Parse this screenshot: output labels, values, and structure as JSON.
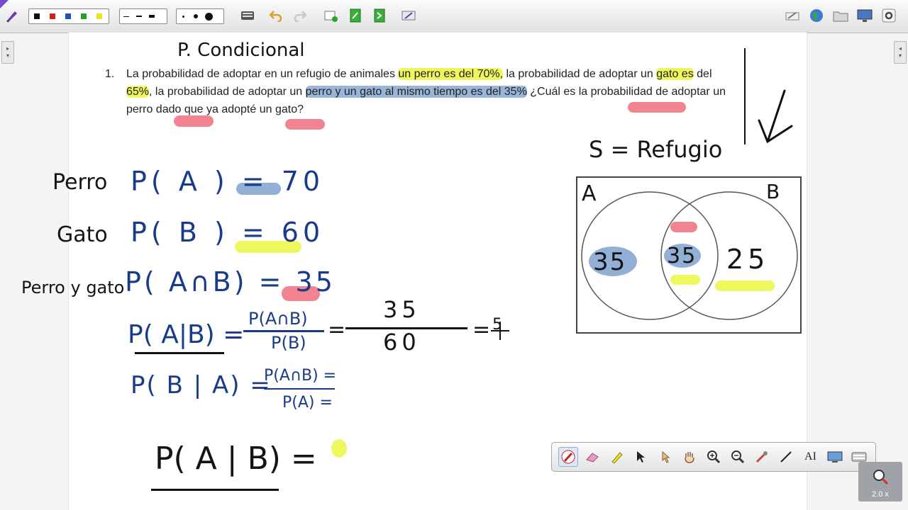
{
  "toolbar": {
    "colors": [
      "#111111",
      "#d81b1b",
      "#1f4fb0",
      "#22a022",
      "#f2e21a"
    ],
    "icons": [
      "pen-icon",
      "keyboard-icon",
      "undo-icon",
      "redo-icon",
      "new-page-icon",
      "green-page-icon",
      "green-page-arrow-icon",
      "tools-icon"
    ],
    "right_icons": [
      "pen-tray-icon",
      "globe-icon",
      "folder-icon",
      "monitor-icon",
      "settings-icon"
    ]
  },
  "problem": {
    "number": "1.",
    "segments": [
      {
        "t": "La probabilidad de adoptar en un refugio de animales ",
        "h": ""
      },
      {
        "t": "un perro es del 70%,",
        "h": "y"
      },
      {
        "t": " la probabilidad de adoptar un ",
        "h": ""
      },
      {
        "t": "gato es",
        "h": "y"
      },
      {
        "t": " del ",
        "h": ""
      },
      {
        "t": "65%",
        "h": "y"
      },
      {
        "t": ", la probabilidad de adoptar un ",
        "h": ""
      },
      {
        "t": "perro y un gato al mismo tiempo es del 35%",
        "h": "b"
      },
      {
        "t": " ¿Cuál es la probabilidad de adoptar un perro dado que ya adopté un gato?",
        "h": ""
      }
    ]
  },
  "handwriting": {
    "title": "P. Condicional",
    "perro": "Perro",
    "gato": "Gato",
    "perro_y_gato": "Perro y gato",
    "pa": "P( A ) = 70",
    "pb": "P( B ) = 60",
    "pab": "P( A∩B) = 35",
    "cond_lhs": "P( A|B) =",
    "cond_num": "P(A∩B)",
    "cond_den": "P(B)",
    "frac_num": "35",
    "frac_den": "60",
    "eq_sign": "=",
    "result_partial": "5",
    "ba_lhs": "P( B | A) =",
    "ba_num": "P(A∩B) =",
    "ba_den": "P(A) =",
    "final_lhs": "P( A | B)  =",
    "s_label": "S = Refugio",
    "venn_a": "A",
    "venn_b": "B",
    "venn_left": "35",
    "venn_mid": "35",
    "venn_right": "25"
  },
  "float_toolbar": {
    "tools": [
      "pen-icon",
      "eraser-icon",
      "highlighter-icon",
      "select-arrow-icon",
      "magic-pointer-icon",
      "pan-hand-icon",
      "zoom-in-icon",
      "zoom-out-icon",
      "screen-pick-icon",
      "line-icon",
      "text-icon",
      "capture-icon",
      "keyboard-icon"
    ],
    "text_tool_label": "AI"
  },
  "zoom": {
    "label": "2.0 x"
  }
}
